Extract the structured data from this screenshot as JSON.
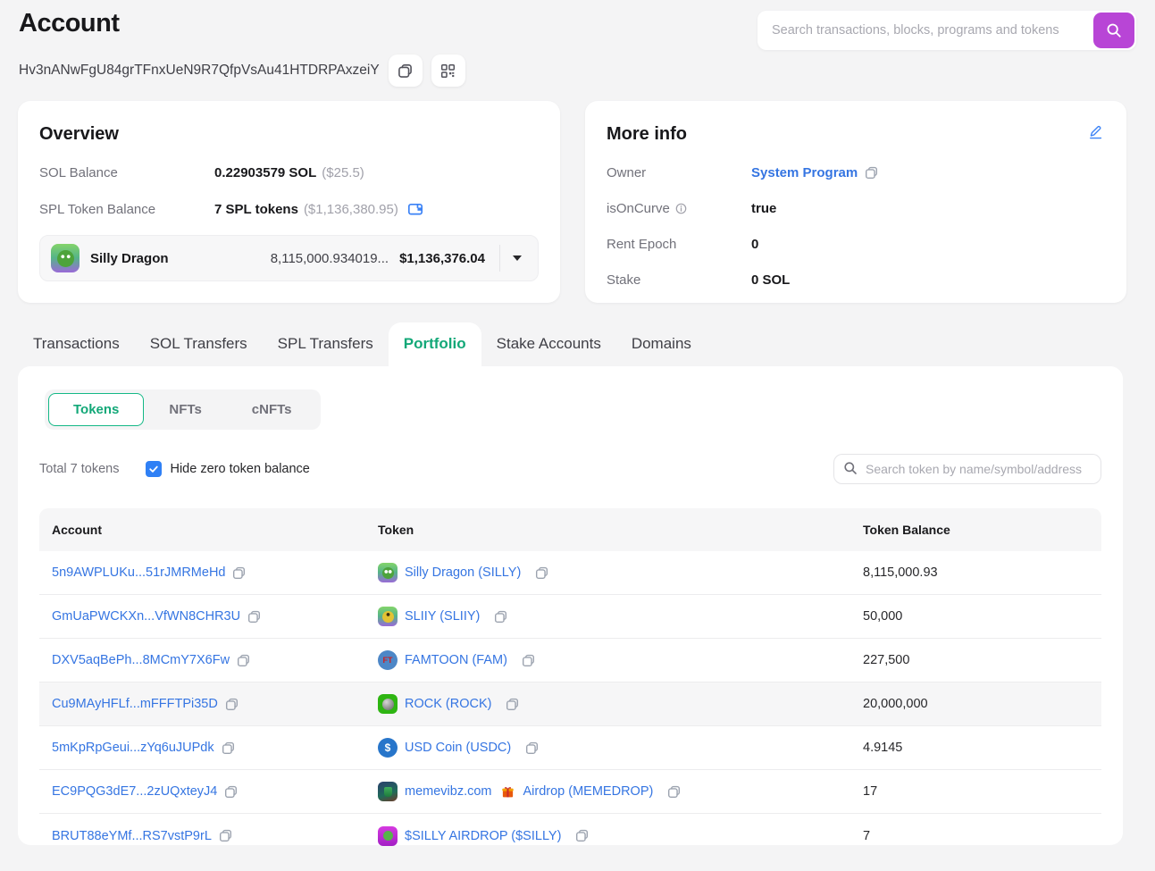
{
  "colors": {
    "accent_green": "#13a878",
    "link_blue": "#3575e2",
    "search_button_purple": "#b845d6",
    "checkbox_blue": "#2f80f5",
    "edit_icon_blue": "#3b82f6"
  },
  "header": {
    "title": "Account",
    "address": "Hv3nANwFgU84grTFnxUeN9R7QfpVsAu41HTDRPAxzeiY",
    "search_placeholder": "Search transactions, blocks, programs and tokens"
  },
  "overview": {
    "title": "Overview",
    "sol_balance": {
      "label": "SOL Balance",
      "value": "0.22903579 SOL",
      "usd": "($25.5)"
    },
    "spl_balance": {
      "label": "SPL Token Balance",
      "value": "7 SPL tokens",
      "usd": "($1,136,380.95)"
    },
    "token_selector": {
      "name": "Silly Dragon",
      "amount": "8,115,000.934019...",
      "usd": "$1,136,376.04"
    }
  },
  "more_info": {
    "title": "More info",
    "owner": {
      "label": "Owner",
      "value": "System Program"
    },
    "is_on_curve": {
      "label": "isOnCurve",
      "value": "true"
    },
    "rent_epoch": {
      "label": "Rent Epoch",
      "value": "0"
    },
    "stake": {
      "label": "Stake",
      "value": "0 SOL"
    }
  },
  "tabs": [
    {
      "label": "Transactions",
      "active": false
    },
    {
      "label": "SOL Transfers",
      "active": false
    },
    {
      "label": "SPL Transfers",
      "active": false
    },
    {
      "label": "Portfolio",
      "active": true
    },
    {
      "label": "Stake Accounts",
      "active": false
    },
    {
      "label": "Domains",
      "active": false
    }
  ],
  "portfolio": {
    "subtabs": [
      {
        "label": "Tokens",
        "active": true
      },
      {
        "label": "NFTs",
        "active": false
      },
      {
        "label": "cNFTs",
        "active": false
      }
    ],
    "total_text": "Total 7 tokens",
    "hide_zero_label": "Hide zero token balance",
    "hide_zero_checked": true,
    "search_placeholder": "Search token by name/symbol/address",
    "table": {
      "headers": [
        "Account",
        "Token",
        "Token Balance"
      ],
      "rows": [
        {
          "account": "5n9AWPLUKu...51rJMRMeHd",
          "token": "Silly Dragon (SILLY)",
          "balance": "8,115,000.93",
          "icon": "silly-dragon"
        },
        {
          "account": "GmUaPWCKXn...VfWN8CHR3U",
          "token": "SLIIY (SLIIY)",
          "balance": "50,000",
          "icon": "sliiy"
        },
        {
          "account": "DXV5aqBePh...8MCmY7X6Fw",
          "token": "FAMTOON (FAM)",
          "balance": "227,500",
          "icon": "famtoon",
          "icon_text": "FT"
        },
        {
          "account": "Cu9MAyHFLf...mFFFTPi35D",
          "token": "ROCK (ROCK)",
          "balance": "20,000,000",
          "icon": "rock",
          "highlighted": true
        },
        {
          "account": "5mKpRpGeui...zYq6uJUPdk",
          "token": "USD Coin (USDC)",
          "balance": "4.9145",
          "icon": "usdc",
          "icon_text": "$"
        },
        {
          "account": "EC9PQG3dE7...2zUQxteyJ4",
          "token": "memevibz.com",
          "token_suffix": "Airdrop (MEMEDROP)",
          "balance": "17",
          "icon": "memedrop"
        },
        {
          "account": "BRUT88eYMf...RS7vstP9rL",
          "token": "$SILLY AIRDROP ($SILLY)",
          "balance": "7",
          "icon": "silly-airdrop"
        }
      ]
    }
  }
}
